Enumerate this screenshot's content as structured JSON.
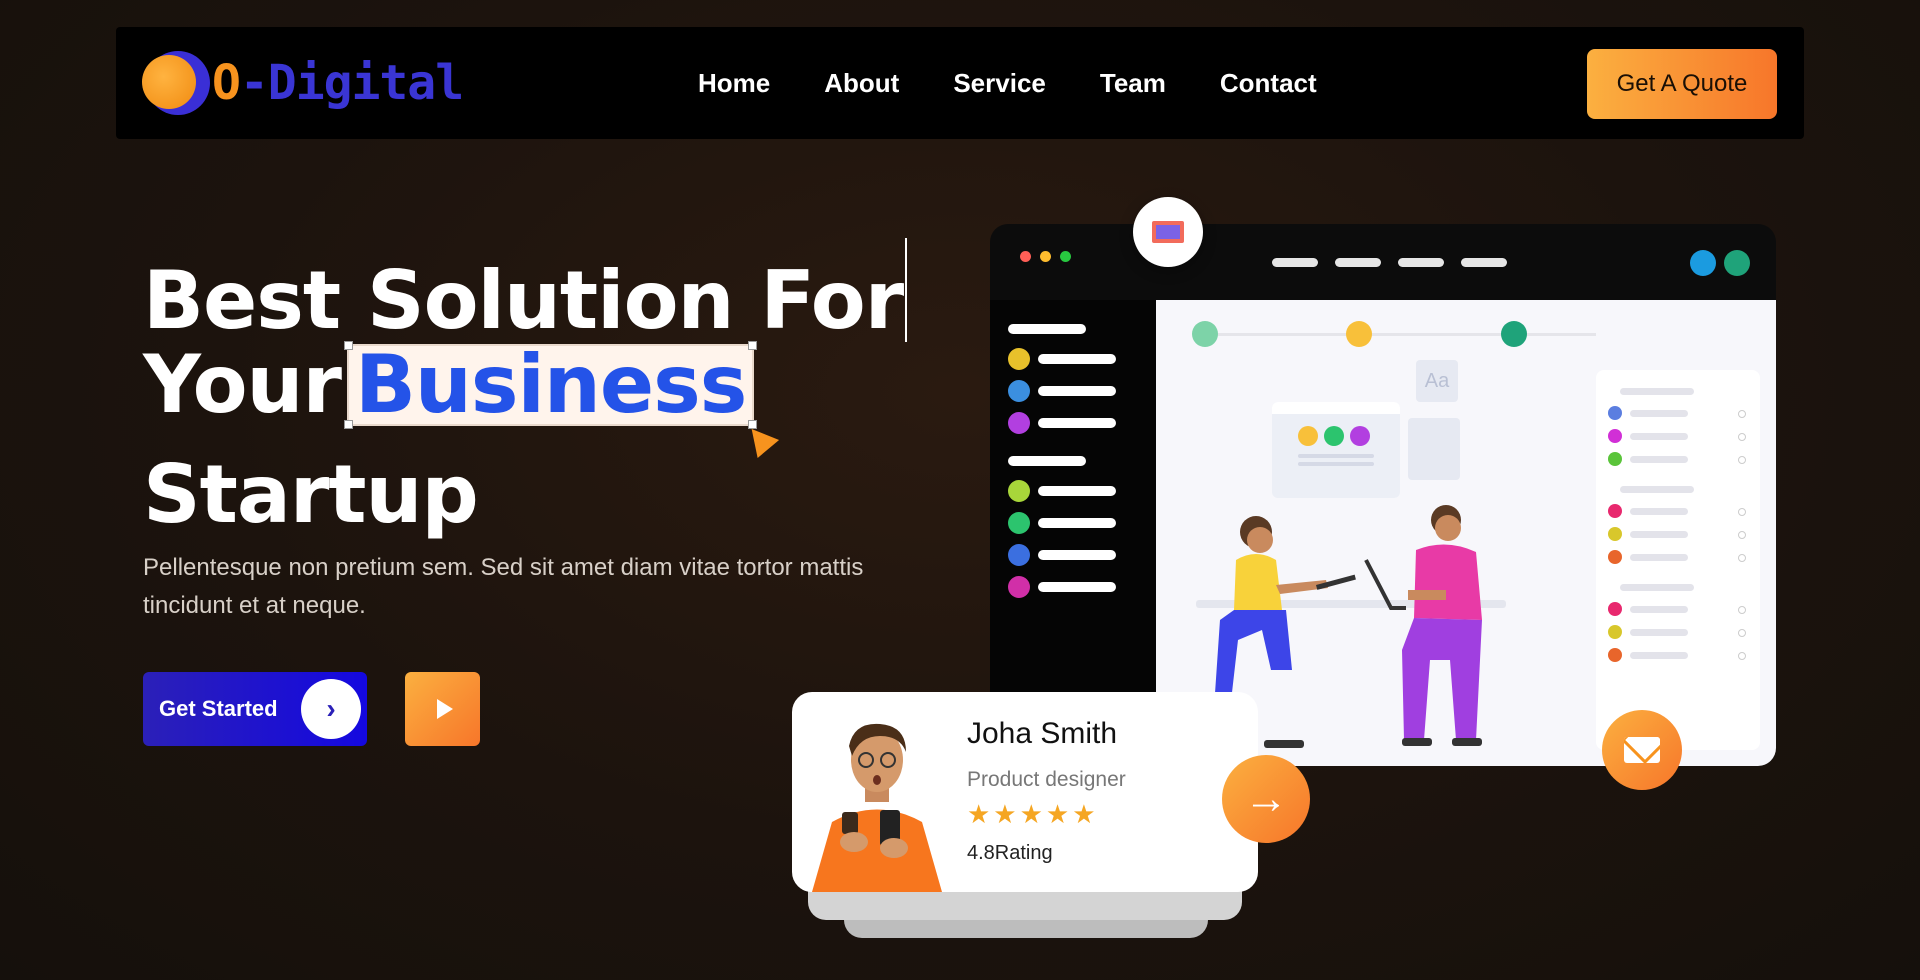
{
  "brand": {
    "logo_prefix": "O",
    "logo_rest": "-Digital"
  },
  "nav": {
    "items": [
      {
        "label": "Home"
      },
      {
        "label": "About"
      },
      {
        "label": "Service"
      },
      {
        "label": "Team"
      },
      {
        "label": "Contact"
      }
    ],
    "quote_label": "Get A Quote"
  },
  "hero": {
    "title_line1": "Best Solution For",
    "title_line2_prefix": "Your",
    "title_highlight": "Business",
    "title_line3": "Startup",
    "description": "Pellentesque non pretium sem. Sed sit amet diam vitae tortor mattis tincidunt et at neque.",
    "cta_label": "Get Started",
    "cta_arrow": "›"
  },
  "profile_card": {
    "name": "Joha Smith",
    "role": "Product designer",
    "stars": "★★★★★",
    "rating": "4.8Rating",
    "arrow": "→"
  },
  "colors": {
    "accent_orange": "#f7931e",
    "brand_blue": "#2b20b8",
    "highlight_blue": "#2453e8"
  },
  "icons": [
    "presentation-chart-icon",
    "mail-icon",
    "play-icon",
    "chevron-right-icon",
    "arrow-right-icon"
  ]
}
